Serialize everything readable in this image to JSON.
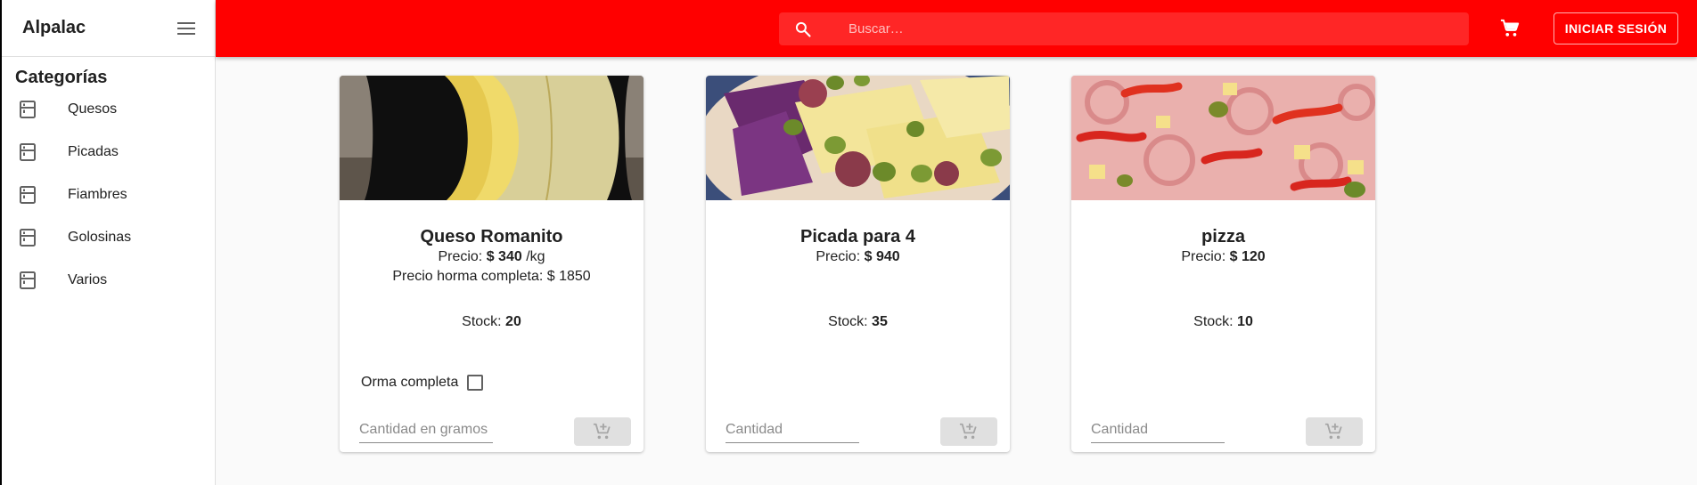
{
  "sidebar": {
    "brand": "Alpalac",
    "categories_title": "Categorías",
    "items": [
      {
        "label": "Quesos",
        "icon": "fridge-icon"
      },
      {
        "label": "Picadas",
        "icon": "fridge-icon"
      },
      {
        "label": "Fiambres",
        "icon": "fridge-icon"
      },
      {
        "label": "Golosinas",
        "icon": "fridge-icon"
      },
      {
        "label": "Varios",
        "icon": "fridge-icon"
      }
    ]
  },
  "header": {
    "search_placeholder": "Buscar…",
    "login_label": "INICIAR SESIÓN",
    "cart_icon": "cart-icon",
    "search_icon": "search-icon"
  },
  "colors": {
    "appbar": "#ff0000",
    "disabled_button": "#e0e0e0"
  },
  "products": [
    {
      "name": "Queso Romanito",
      "price_label": "Precio: ",
      "price_value": "$ 340",
      "price_unit": " /kg",
      "whole_price": "Precio horma completa: $ 1850",
      "stock_label": "Stock: ",
      "stock_value": "20",
      "whole_checkbox_label": "Orma completa",
      "qty_placeholder": "Cantidad en gramos"
    },
    {
      "name": "Picada para 4",
      "price_label": "Precio: ",
      "price_value": "$ 940",
      "stock_label": "Stock: ",
      "stock_value": "35",
      "qty_placeholder": "Cantidad"
    },
    {
      "name": "pizza",
      "price_label": "Precio: ",
      "price_value": "$ 120",
      "stock_label": "Stock: ",
      "stock_value": "10",
      "qty_placeholder": "Cantidad"
    }
  ]
}
